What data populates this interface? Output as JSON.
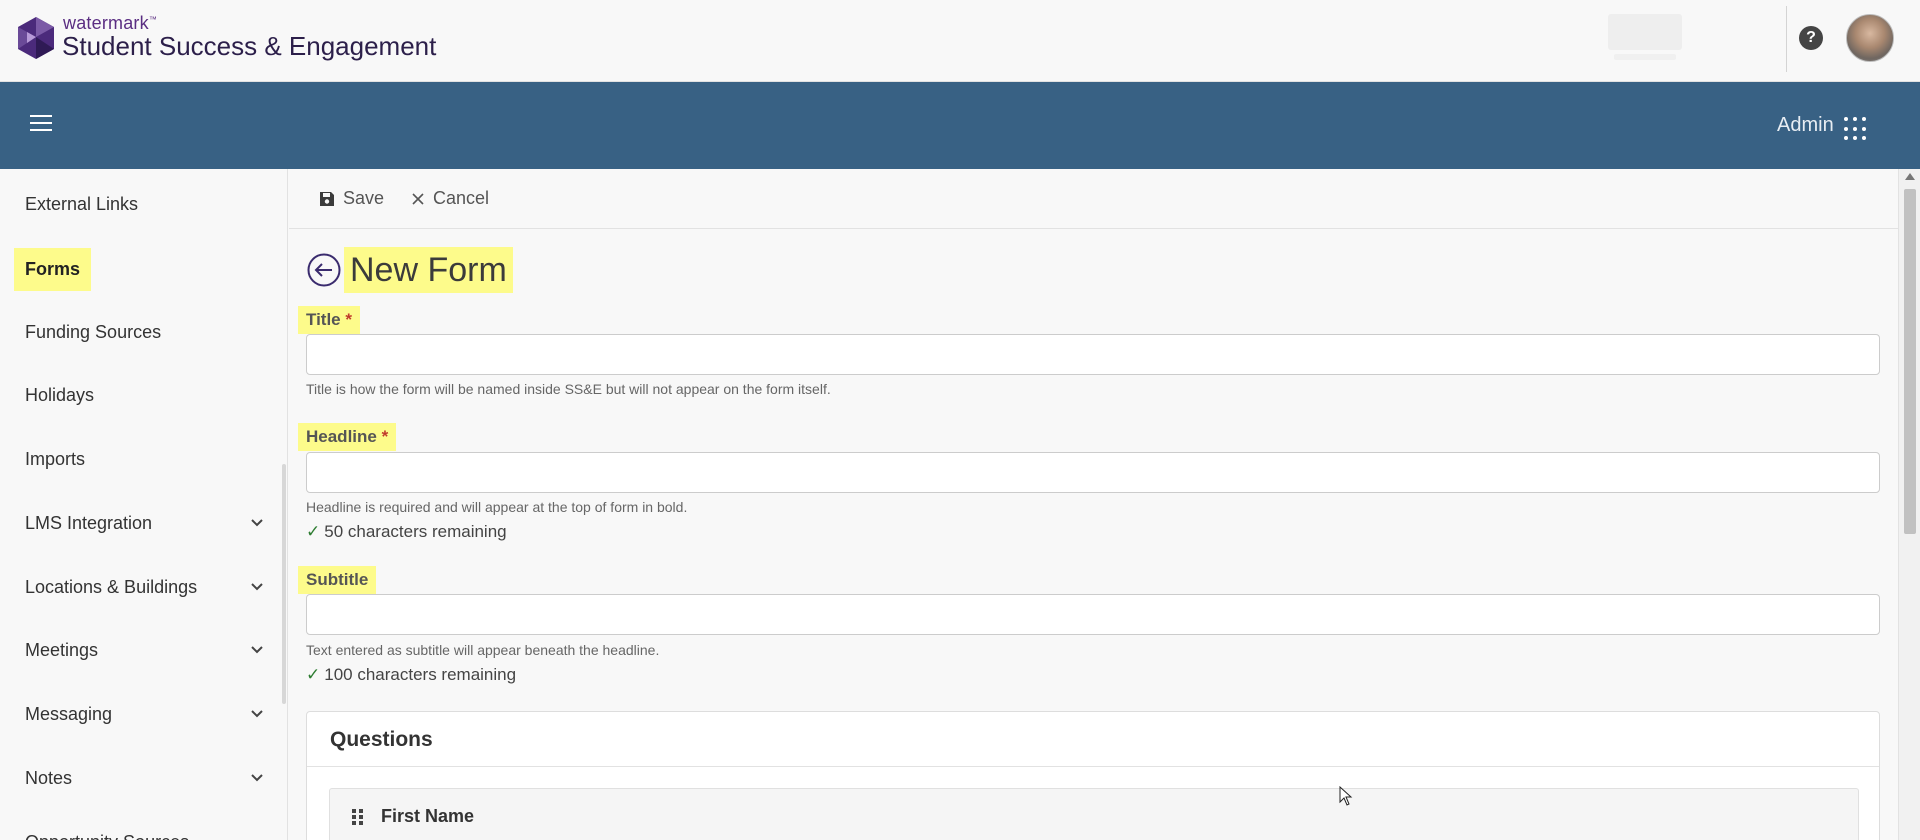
{
  "header": {
    "brand_small": "watermark",
    "brand_tm": "™",
    "brand_title": "Student Success & Engagement",
    "help_icon": "?",
    "colors": {
      "brand": "#5a2d82",
      "nav": "#386184",
      "highlight": "#fdfb8b"
    }
  },
  "navbar": {
    "menu_icon": "hamburger-icon",
    "admin_label": "Admin",
    "apps_icon": "grid-dots-icon"
  },
  "sidebar": {
    "items": [
      {
        "label": "External Links",
        "expandable": false,
        "active": false
      },
      {
        "label": "Forms",
        "expandable": false,
        "active": true
      },
      {
        "label": "Funding Sources",
        "expandable": false,
        "active": false
      },
      {
        "label": "Holidays",
        "expandable": false,
        "active": false
      },
      {
        "label": "Imports",
        "expandable": false,
        "active": false
      },
      {
        "label": "LMS Integration",
        "expandable": true,
        "active": false
      },
      {
        "label": "Locations & Buildings",
        "expandable": true,
        "active": false
      },
      {
        "label": "Meetings",
        "expandable": true,
        "active": false
      },
      {
        "label": "Messaging",
        "expandable": true,
        "active": false
      },
      {
        "label": "Notes",
        "expandable": true,
        "active": false
      },
      {
        "label": "Opportunity Sources",
        "expandable": false,
        "active": false
      }
    ]
  },
  "toolbar": {
    "save_label": "Save",
    "cancel_label": "Cancel"
  },
  "form": {
    "page_title": "New Form",
    "title_field": {
      "label": "Title",
      "required_mark": "*",
      "value": "",
      "hint": "Title is how the form will be named inside SS&E but will not appear on the form itself."
    },
    "headline_field": {
      "label": "Headline",
      "required_mark": "*",
      "value": "",
      "hint": "Headline is required and will appear at the top of form in bold.",
      "remaining": "50 characters remaining"
    },
    "subtitle_field": {
      "label": "Subtitle",
      "value": "",
      "hint": "Text entered as subtitle will appear beneath the headline.",
      "remaining": "100 characters remaining"
    }
  },
  "questions": {
    "title": "Questions",
    "items": [
      {
        "label": "First Name"
      }
    ]
  }
}
